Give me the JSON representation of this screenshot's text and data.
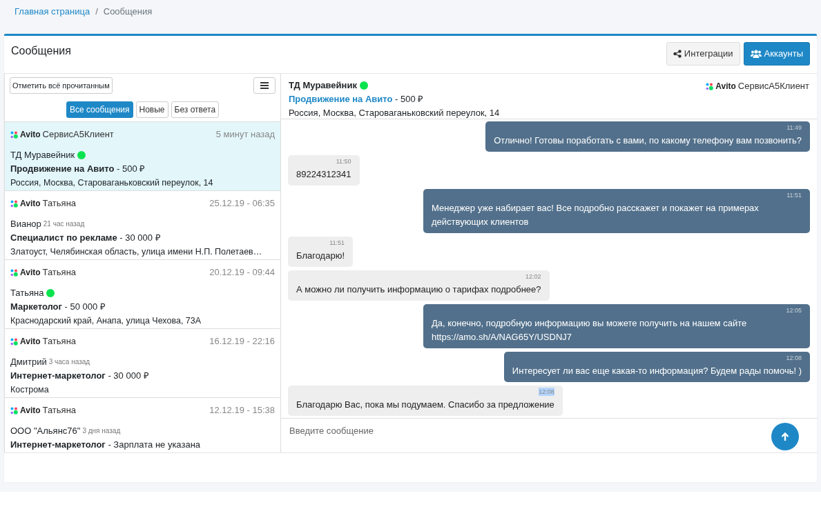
{
  "breadcrumb": [
    {
      "label": "Главная страница",
      "link": true
    },
    {
      "label": "Сообщения",
      "link": false
    }
  ],
  "breadcrumb_separator": "/",
  "card": {
    "title": "Сообщения",
    "buttons": [
      {
        "label": "Интеграции",
        "kind": "share",
        "primary": false
      },
      {
        "label": "Аккаунты",
        "kind": "users",
        "primary": true
      }
    ]
  },
  "sidebar": {
    "mark_read_button": "Отметить всё прочитанным",
    "filters": [
      {
        "label": "Все сообщения",
        "selected": true
      },
      {
        "label": "Новые",
        "selected": false
      },
      {
        "label": "Без ответа",
        "selected": false
      }
    ],
    "conversations": [
      {
        "channel": "Avito",
        "account": "СервисА5Клиент",
        "time": "5 минут назад",
        "contact": "ТД Муравейник",
        "online": true,
        "title": "Продвижение на Авито",
        "price": "- 500 ₽",
        "address": "Россия, Москва, Староваганьковский переулок, 14",
        "selected": true
      },
      {
        "channel": "Avito",
        "account": "Татьяна",
        "time": "25.12.19 - 06:35",
        "contact": "Вианор",
        "online": false,
        "last_seen": "21 час назад",
        "title": "Специалист по рекламе",
        "price": "- 30 000 ₽",
        "address": "Златоуст, Челябинская область, улица имени Н.П. Полетаев…",
        "selected": false
      },
      {
        "channel": "Avito",
        "account": "Татьяна",
        "time": "20.12.19 - 09:44",
        "contact": "Татьяна",
        "online": true,
        "title": "Маркетолог",
        "price": "- 50 000 ₽",
        "address": "Краснодарский край, Анапа, улица Чехова, 73А",
        "selected": false
      },
      {
        "channel": "Avito",
        "account": "Татьяна",
        "time": "16.12.19 - 22:16",
        "contact": "Дмитрий",
        "online": false,
        "last_seen": "3 часа назад",
        "title": "Интернет-маркетолог",
        "price": "- 30 000 ₽",
        "address": "Кострома",
        "selected": false
      },
      {
        "channel": "Avito",
        "account": "Татьяна",
        "time": "12.12.19 - 15:38",
        "contact": "ООО \"Альянс76\"",
        "online": false,
        "last_seen": "3 дня назад",
        "title": "Интернет-маркетолог",
        "price": "- Зарплата не указана",
        "selected": false
      }
    ]
  },
  "chat": {
    "contact": "ТД Муравейник",
    "online": true,
    "title": "Продвижение на Авито",
    "price": "- 500 ₽",
    "address": "Россия, Москва, Староваганьковский переулок, 14",
    "channel": "Avito",
    "account": "СервисА5Клиент",
    "messages": [
      {
        "kind": "out",
        "time": "11:49",
        "text": "Отлично! Готовы поработать с вами, по какому телефону вам позвонить?",
        "highlighted": false
      },
      {
        "kind": "in",
        "time": "11:50",
        "text": "89224312341",
        "highlighted": false
      },
      {
        "kind": "out",
        "time": "11:51",
        "text": "Менеджер уже набирает вас! Все подробно расскажет и покажет на примерах действующих клиентов",
        "highlighted": false
      },
      {
        "kind": "in",
        "time": "11:51",
        "text": "Благодарю!",
        "highlighted": false
      },
      {
        "kind": "in",
        "time": "12:02",
        "text": "А можно ли получить информацию о тарифах подробнее?",
        "highlighted": false
      },
      {
        "kind": "out",
        "time": "12:05",
        "text": "Да, конечно, подробную информацию вы можете получить на нашем сайте https://amo.sh/A/NAG65Y/USDNJ7",
        "highlighted": false
      },
      {
        "kind": "out",
        "time": "12:08",
        "text": "Интересует ли вас еще какая-то информация? Будем рады помочь! )",
        "highlighted": false
      },
      {
        "kind": "in",
        "time": "12:08",
        "text": "Благодарю Вас, пока мы подумаем. Спасибо за предложение",
        "highlighted": true
      }
    ],
    "input_placeholder": "Введите сообщение"
  }
}
